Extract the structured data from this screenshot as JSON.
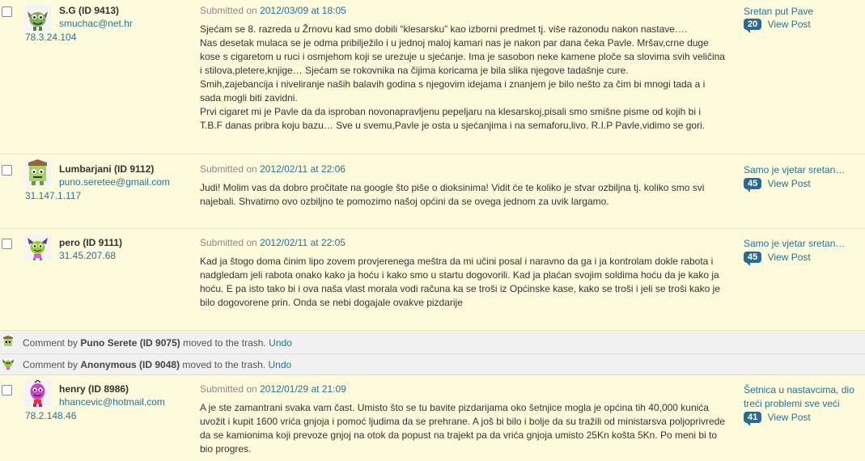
{
  "comments_top": [
    {
      "author": "S.G (ID 9413)",
      "email": "smuchac@net.hr",
      "ip": "78.3.24.104",
      "submitted_prefix": "Submitted on",
      "date": "2012/03/09 at 18:05",
      "paragraphs": [
        "Sjećam se 8. razreda u Žrnovu kad smo dobili “klesarsku” kao izborni predmet tj. više razonodu nakon nastave….",
        "Nas desetak mulaca se je odma pribilježilo i u jednoj maloj kamari nas je nakon par dana čeka Pavle. Mršav,crne duge kose s cigaretom u ruci i osmjehom koji se urezuje u sjećanje. Ima je sasobon neke kamene ploče sa slovima svih veličina i stilova,pletere,knjige… Sjećam se rokovnika na čijima koricama je bila slika njegove tadašnje cure.",
        "Smih,zajebancija i niveliranje naših balavih godina s njegovim idejama i znanjem je bilo nešto za čim bi mnogi tada a i sada mogli biti zavidni.",
        "Prvi cigaret mi je Pavle da da isproban novonapravljenu pepeljaru na klesarskoj,pisali smo smišne pisme od kojih bi i T.B.F danas pribra koju bazu… Sve u svemu,Pavle je osta u sjećanjima i na semaforu,livo. R.I.P Pavle,vidimo se gori."
      ],
      "post_title": "Sretan put Pave",
      "count": "20",
      "view_post": "View Post",
      "avatar_color": "#6a9a4a"
    },
    {
      "author": "Lumbarjani (ID 9112)",
      "email": "puno.seretee@gmail.com",
      "ip": "31.147.1.117",
      "submitted_prefix": "Submitted on",
      "date": "2012/02/11 at 22:06",
      "paragraphs": [
        "Judi! Molim vas da dobro pročitate na google što piše o dioksinima! Vidit će te koliko je stvar ozbiljna tj. koliko smo svi najebali. Shvatimo ovo ozbiljno te pomozimo našoj općini da se ovega jednom za uvik largamo."
      ],
      "post_title": "Samo je vjetar sretan…",
      "count": "45",
      "view_post": "View Post",
      "avatar_color": "#8fbf5a"
    },
    {
      "author": "pero (ID 9111)",
      "email": "",
      "ip": "31.45.207.68",
      "submitted_prefix": "Submitted on",
      "date": "2012/02/11 at 22:05",
      "paragraphs": [
        "Kad ja štogo doma činim lipo zovem provjerenega meštra da mi učini posal i naravno da ga i ja kontrolam dokle rabota i nadgledam jeli rabota onako kako ja hoću i kako smo u startu dogovorili. Kad ja plaćan svojim soldima hoću da je kako ja hoću. E pa isto tako bi i ova naša vlast morala vodi računa ka se troši iz Općinske kase, kako se troši i jeli se troši kako je bilo dogovorene prin. Onda se nebi dogajale ovakve pizdarije"
      ],
      "post_title": "Samo je vjetar sretan…",
      "count": "45",
      "view_post": "View Post",
      "avatar_color": "#9acd32"
    }
  ],
  "trash_notices": [
    {
      "prefix": "Comment by",
      "author": "Puno Serete (ID 9075)",
      "suffix": "moved to the trash.",
      "undo": "Undo"
    },
    {
      "prefix": "Comment by",
      "author": "Anonymous (ID 9048)",
      "suffix": "moved to the trash.",
      "undo": "Undo"
    }
  ],
  "comment_bottom": {
    "author": "henry (ID 8986)",
    "email": "hhancevic@hotmail.com",
    "ip": "78.2.148.46",
    "submitted_prefix": "Submitted on",
    "date": "2012/01/29 at 21:09",
    "paragraphs": [
      "A je ste zamantrani svaka vam čast. Umisto što se tu bavite pizdarijama oko šetnjice mogla je općina tih 40,000 kunića uvožit i kupit 1600 vrića gnjoja i pomoć ljudima da se prehrane. A još bi bilo i bolje da su tražili od ministarsva poljoprivrede da se kamionima koji prevoze gnjoj na otok da popust na trajekt pa da vrića gnjoja umisto 25Kn košta 5Kn. Po meni bi to bio progres."
    ],
    "post_title": "Šetnica u nastavcima, dio treći problemi sve veći",
    "count": "41",
    "view_post": "View Post",
    "avatar_color": "#cc44cc"
  }
}
